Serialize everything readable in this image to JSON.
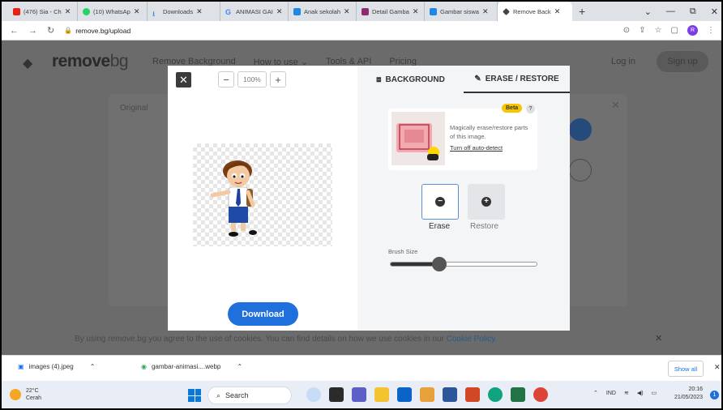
{
  "browser": {
    "tabs": [
      {
        "label": "(476) Sia - Ch",
        "color": "#e62117"
      },
      {
        "label": "(10) WhatsAp",
        "color": "#25d366"
      },
      {
        "label": "Downloads",
        "color": "#1a73e8"
      },
      {
        "label": "ANIMASI GAI",
        "color": "#4285f4"
      },
      {
        "label": "Anak sekolah",
        "color": "#1e88e5"
      },
      {
        "label": "Detail Gamba",
        "color": "#8e2c6f"
      },
      {
        "label": "Gambar siswa",
        "color": "#1e88e5"
      },
      {
        "label": "Remove Back",
        "color": "#444444"
      }
    ],
    "url": "remove.bg/upload",
    "profile_initial": "R"
  },
  "site": {
    "logo": "remove",
    "logo_suffix": "bg",
    "nav": [
      "Remove Background",
      "How to use",
      "Tools & API",
      "Pricing"
    ],
    "login": "Log in",
    "signup": "Sign up",
    "original_tab": "Original",
    "cookie_text": "By using remove.bg you agree to the use of cookies. You can find details on how we use cookies in our",
    "cookie_link": "Cookie Policy."
  },
  "modal": {
    "zoom_value": "100%",
    "tab_background": "BACKGROUND",
    "tab_erase": "ERASE / RESTORE",
    "beta": "Beta",
    "help": "?",
    "tip_text": "Magically erase/restore parts of this image.",
    "tip_link": "Turn off auto-detect",
    "erase_label": "Erase",
    "restore_label": "Restore",
    "brush_label": "Brush Size",
    "brush_level": 0.33,
    "download": "Download"
  },
  "downloads": {
    "items": [
      "images (4).jpeg",
      "gambar-animasi....webp"
    ],
    "show_all": "Show all"
  },
  "taskbar": {
    "temp": "22°C",
    "weather": "Cerah",
    "search": "Search",
    "lang": "IND",
    "time": "20:16",
    "date": "21/05/2023"
  }
}
